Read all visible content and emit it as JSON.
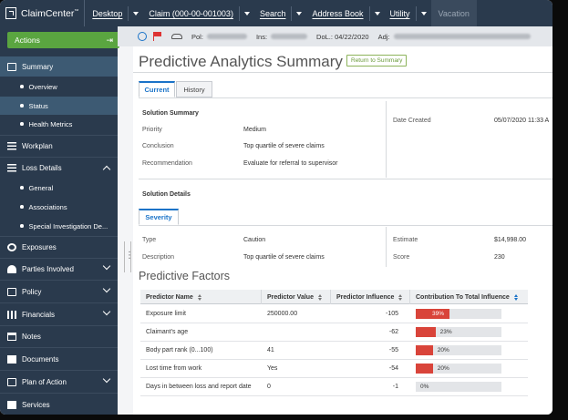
{
  "app": {
    "name": "ClaimCenter",
    "trademark": "™",
    "colors": {
      "nav_bg": "#2a3a4d",
      "accent": "#1a73c8",
      "actions_green": "#5aa540",
      "bar_red": "#d9443a"
    }
  },
  "topnav": {
    "items": [
      {
        "label": "Desktop",
        "has_menu": true
      },
      {
        "label": "Claim (000-00-001003)",
        "has_menu": true
      },
      {
        "label": "Search",
        "has_menu": true
      },
      {
        "label": "Address Book",
        "has_menu": true
      },
      {
        "label": "Utility",
        "has_menu": true
      },
      {
        "label": "Vacation",
        "has_menu": false,
        "disabled": true
      }
    ]
  },
  "infobar": {
    "pol_label": "Pol:",
    "ins_label": "Ins:",
    "dol_label": "DoL.:",
    "dol_value": "04/22/2020",
    "adj_label": "Adj:"
  },
  "sidebar": {
    "actions_label": "Actions",
    "items": [
      {
        "label": "Summary",
        "icon": "clipboard-icon",
        "active": true
      },
      {
        "label": "Overview",
        "sub": true
      },
      {
        "label": "Status",
        "sub": true,
        "active": true
      },
      {
        "label": "Health Metrics",
        "sub": true
      },
      {
        "label": "Workplan",
        "icon": "list-icon"
      },
      {
        "label": "Loss Details",
        "icon": "list-icon",
        "expanded": true
      },
      {
        "label": "General",
        "sub": true
      },
      {
        "label": "Associations",
        "sub": true
      },
      {
        "label": "Special Investigation De...",
        "sub": true
      },
      {
        "label": "Exposures",
        "icon": "gear-icon"
      },
      {
        "label": "Parties Involved",
        "icon": "people-icon",
        "collapsible": true
      },
      {
        "label": "Policy",
        "icon": "document-icon",
        "collapsible": true
      },
      {
        "label": "Financials",
        "icon": "chart-icon",
        "collapsible": true
      },
      {
        "label": "Notes",
        "icon": "note-icon"
      },
      {
        "label": "Documents",
        "icon": "folder-icon"
      },
      {
        "label": "Plan of Action",
        "icon": "document-icon",
        "collapsible": true
      },
      {
        "label": "Services",
        "icon": "wrench-icon"
      }
    ]
  },
  "page": {
    "title": "Predictive Analytics Summary",
    "return_label": "Return to Summary",
    "tabs": [
      {
        "label": "Current",
        "active": true
      },
      {
        "label": "History"
      }
    ],
    "solution_summary": {
      "title": "Solution Summary",
      "rows": [
        {
          "label": "Priority",
          "value": "Medium"
        },
        {
          "label": "Conclusion",
          "value": "Top quartile of severe claims"
        },
        {
          "label": "Recommendation",
          "value": "Evaluate for referral to supervisor"
        }
      ],
      "date_created_label": "Date Created",
      "date_created_value": "05/07/2020 11:33 A"
    },
    "solution_details": {
      "title": "Solution Details",
      "tab_label": "Severity",
      "rows": [
        {
          "label": "Type",
          "value": "Caution"
        },
        {
          "label": "Description",
          "value": "Top quartile of severe claims"
        }
      ],
      "right_rows": [
        {
          "label": "Estimate",
          "value": "$14,998.00"
        },
        {
          "label": "Score",
          "value": "230"
        }
      ]
    },
    "predictive_factors": {
      "title": "Predictive Factors",
      "columns": [
        "Predictor Name",
        "Predictor Value",
        "Predictor Influence",
        "Contribution To Total Influence"
      ],
      "rows": [
        {
          "name": "Exposure limit",
          "value": "250000.00",
          "influence": "-105",
          "contribution": 39,
          "contribution_label": "39%"
        },
        {
          "name": "Claimant's age",
          "value": "",
          "influence": "-62",
          "contribution": 23,
          "contribution_label": "23%"
        },
        {
          "name": "Body part rank (0...100)",
          "value": "41",
          "influence": "-55",
          "contribution": 20,
          "contribution_label": "20%"
        },
        {
          "name": "Lost time from work",
          "value": "Yes",
          "influence": "-54",
          "contribution": 20,
          "contribution_label": "20%"
        },
        {
          "name": "Days in between loss and report date",
          "value": "0",
          "influence": "-1",
          "contribution": 0,
          "contribution_label": "0%"
        }
      ]
    }
  }
}
